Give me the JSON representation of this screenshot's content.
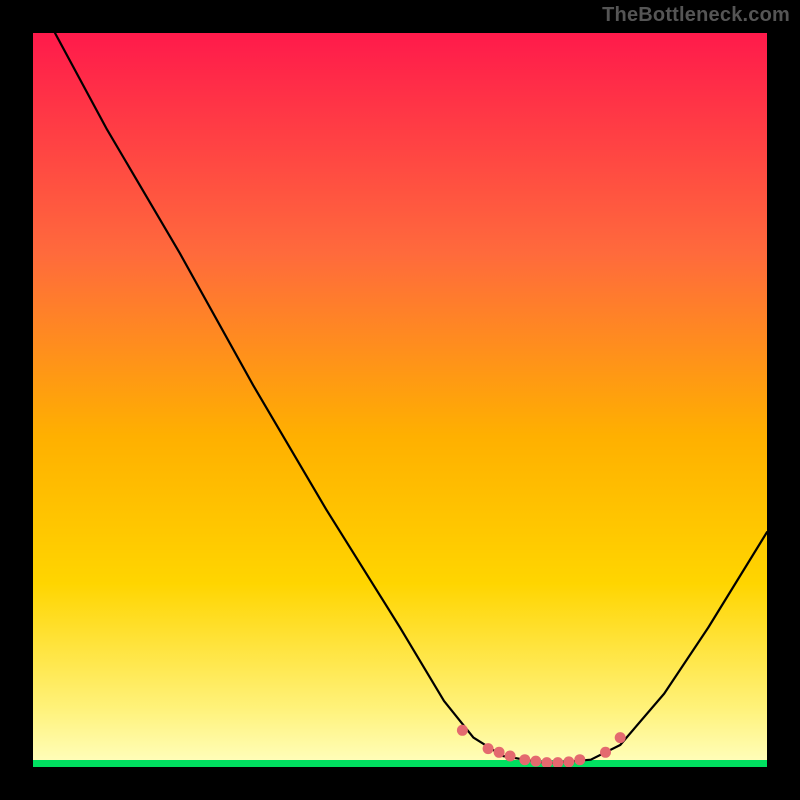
{
  "watermark": "TheBottleneck.com",
  "chart_data": {
    "type": "line",
    "title": "",
    "xlabel": "",
    "ylabel": "",
    "xlim": [
      0,
      100
    ],
    "ylim": [
      0,
      100
    ],
    "grid": false,
    "legend": false,
    "gradient": {
      "top": "#ff1a4b",
      "mid": "#ffd500",
      "bottom": "#fff27a",
      "band": "#00e060"
    },
    "curve": [
      {
        "x": 3.0,
        "y": 100.0
      },
      {
        "x": 10.0,
        "y": 87.0
      },
      {
        "x": 20.0,
        "y": 70.0
      },
      {
        "x": 30.0,
        "y": 52.0
      },
      {
        "x": 40.0,
        "y": 35.0
      },
      {
        "x": 50.0,
        "y": 19.0
      },
      {
        "x": 56.0,
        "y": 9.0
      },
      {
        "x": 60.0,
        "y": 4.0
      },
      {
        "x": 64.0,
        "y": 1.5
      },
      {
        "x": 70.0,
        "y": 0.5
      },
      {
        "x": 76.0,
        "y": 1.0
      },
      {
        "x": 80.0,
        "y": 3.0
      },
      {
        "x": 86.0,
        "y": 10.0
      },
      {
        "x": 92.0,
        "y": 19.0
      },
      {
        "x": 100.0,
        "y": 32.0
      }
    ],
    "markers_pink": [
      {
        "x": 58.5,
        "y": 5.0
      },
      {
        "x": 62.0,
        "y": 2.5
      },
      {
        "x": 63.5,
        "y": 2.0
      },
      {
        "x": 65.0,
        "y": 1.5
      },
      {
        "x": 67.0,
        "y": 1.0
      },
      {
        "x": 68.5,
        "y": 0.8
      },
      {
        "x": 70.0,
        "y": 0.6
      },
      {
        "x": 71.5,
        "y": 0.6
      },
      {
        "x": 73.0,
        "y": 0.7
      },
      {
        "x": 74.5,
        "y": 1.0
      },
      {
        "x": 78.0,
        "y": 2.0
      },
      {
        "x": 80.0,
        "y": 4.0
      }
    ]
  }
}
